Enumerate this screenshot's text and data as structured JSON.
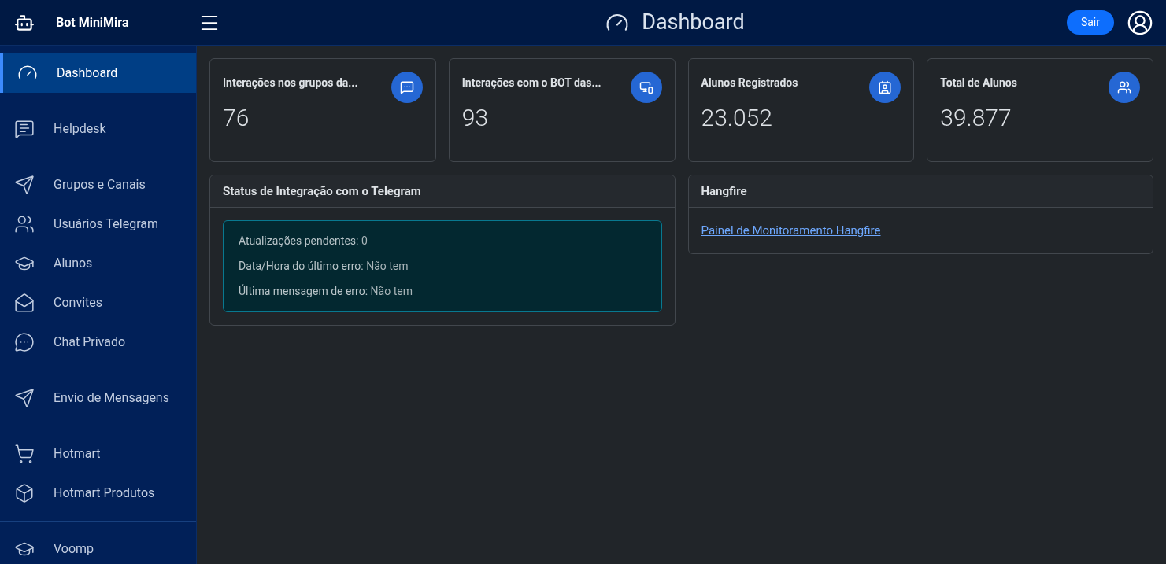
{
  "brand": "Bot MiniMira",
  "header": {
    "title": "Dashboard",
    "logout": "Sair"
  },
  "sidebar": {
    "groups": [
      {
        "items": [
          {
            "label": "Dashboard",
            "selected": true
          }
        ]
      },
      {
        "items": [
          {
            "label": "Helpdesk",
            "selected": false
          }
        ]
      },
      {
        "items": [
          {
            "label": "Grupos e Canais",
            "selected": false
          },
          {
            "label": "Usuários Telegram",
            "selected": false
          },
          {
            "label": "Alunos",
            "selected": false
          },
          {
            "label": "Convites",
            "selected": false
          },
          {
            "label": "Chat Privado",
            "selected": false
          }
        ]
      },
      {
        "items": [
          {
            "label": "Envio de Mensagens",
            "selected": false
          }
        ]
      },
      {
        "items": [
          {
            "label": "Hotmart",
            "selected": false
          },
          {
            "label": "Hotmart Produtos",
            "selected": false
          }
        ]
      },
      {
        "items": [
          {
            "label": "Voomp",
            "selected": false
          }
        ]
      }
    ]
  },
  "stats": [
    {
      "title": "Interações nos grupos da...",
      "value": "76"
    },
    {
      "title": "Interações com o BOT das...",
      "value": "93"
    },
    {
      "title": "Alunos Registrados",
      "value": "23.052"
    },
    {
      "title": "Total de Alunos",
      "value": "39.877"
    }
  ],
  "telegram_status": {
    "title": "Status de Integração com o Telegram",
    "lines": [
      {
        "label": "Atualizações pendentes:",
        "value": "0"
      },
      {
        "label": "Data/Hora do último erro:",
        "value": "Não tem"
      },
      {
        "label": "Última mensagem de erro:",
        "value": "Não tem"
      }
    ]
  },
  "hangfire": {
    "title": "Hangfire",
    "link": "Painel de Monitoramento Hangfire"
  }
}
